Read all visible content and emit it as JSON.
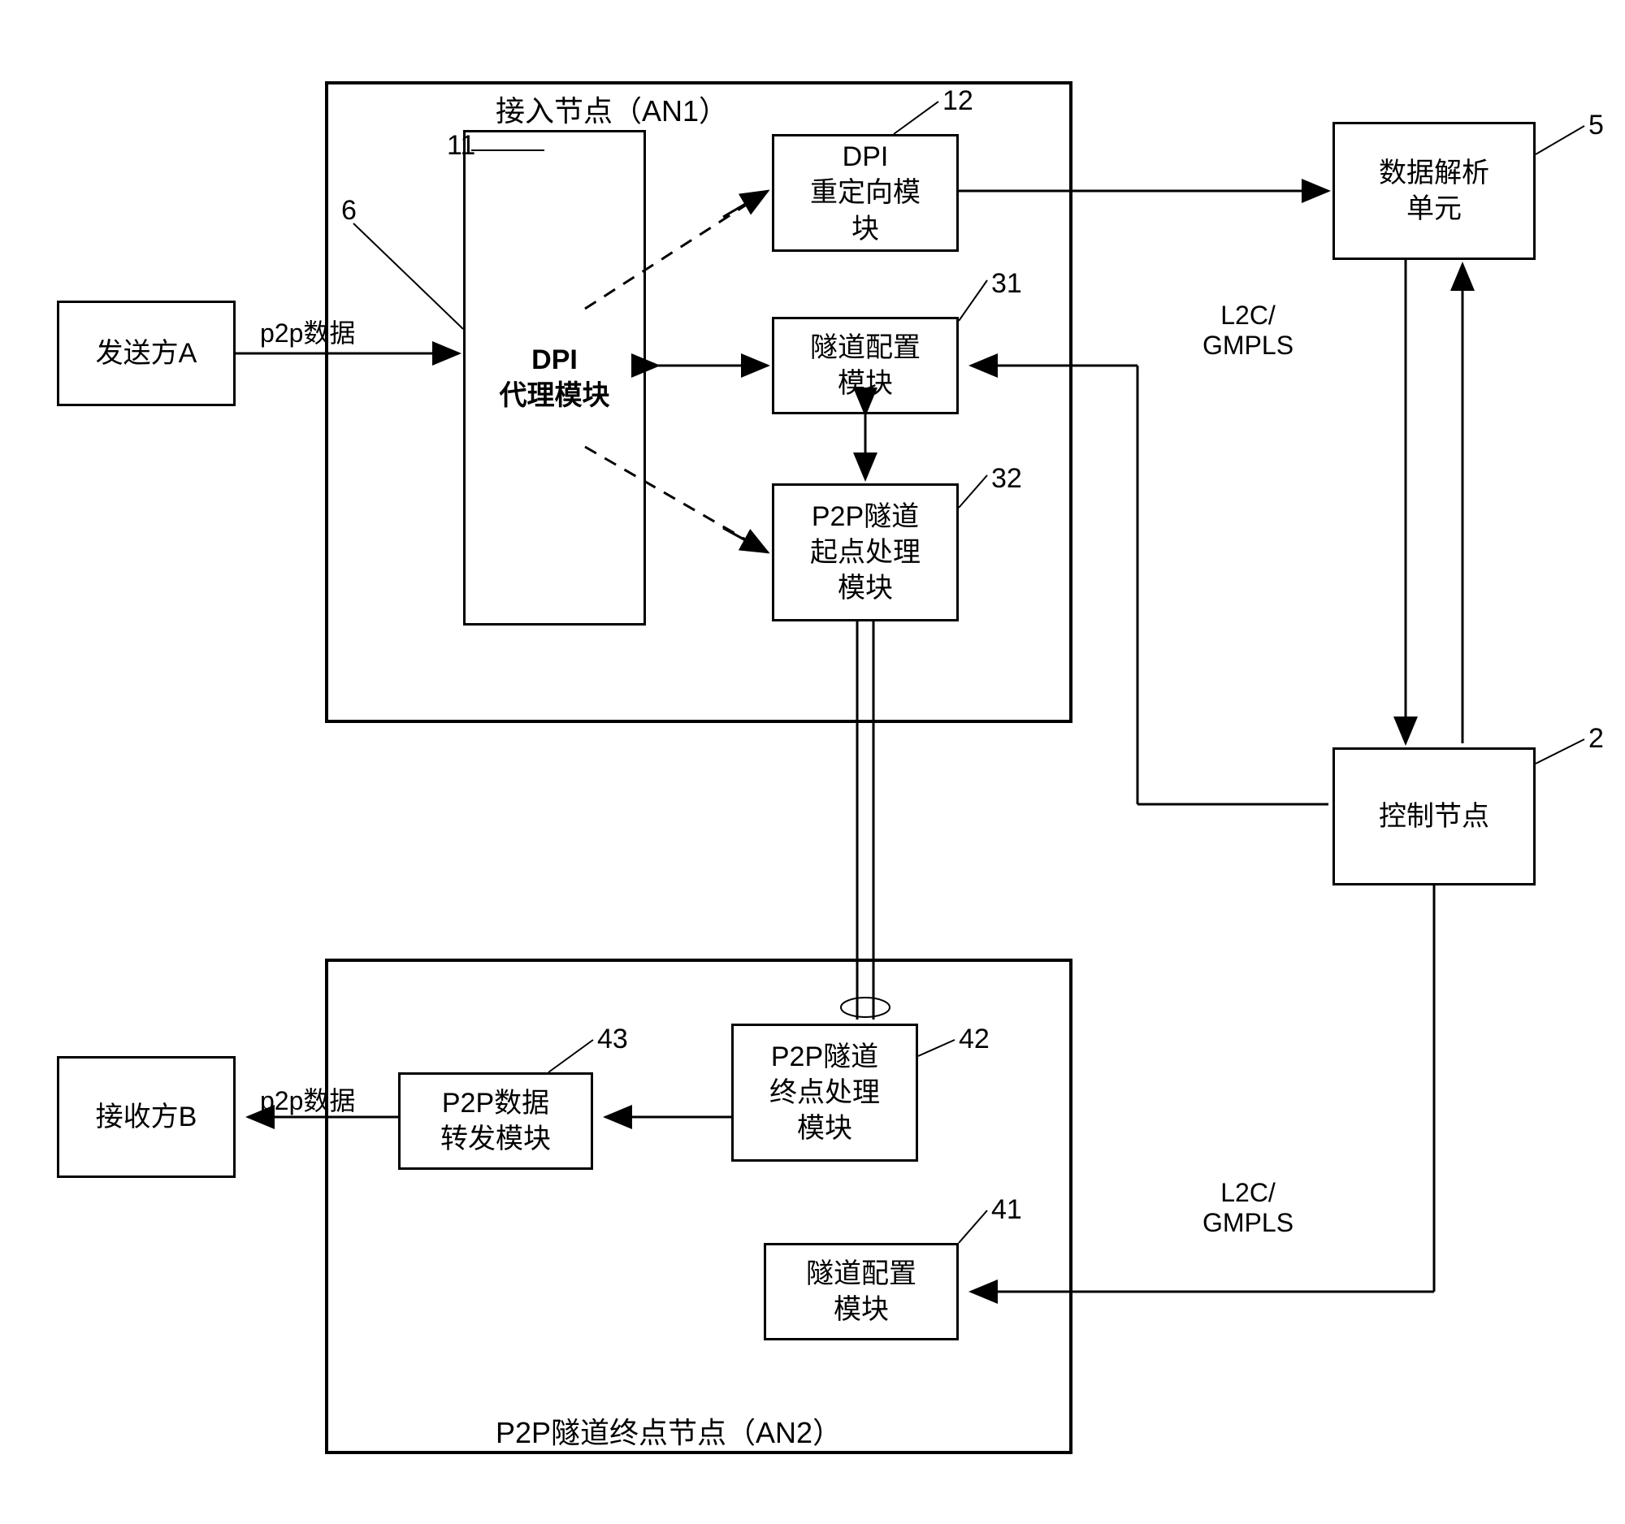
{
  "nodes": {
    "sender": "发送方A",
    "receiver": "接收方B",
    "dpi_proxy": "DPI\n代理模块",
    "dpi_redirect": "DPI\n重定向模\n块",
    "tunnel_config_1": "隧道配置\n模块",
    "p2p_tunnel_start": "P2P隧道\n起点处理\n模块",
    "data_parse": "数据解析\n单元",
    "control_node": "控制节点",
    "p2p_data_forward": "P2P数据\n转发模块",
    "p2p_tunnel_end": "P2P隧道\n终点处理\n模块",
    "tunnel_config_2": "隧道配置\n模块"
  },
  "containers": {
    "an1": "接入节点（AN1）",
    "an2": "P2P隧道终点节点（AN2）"
  },
  "labels": {
    "p2p_data_top": "p2p数据",
    "p2p_data_bottom": "p2p数据",
    "l2c_gmpls_top": "L2C/\nGMPLS",
    "l2c_gmpls_bottom": "L2C/\nGMPLS"
  },
  "refs": {
    "r6": "6",
    "r11": "11",
    "r12": "12",
    "r31": "31",
    "r32": "32",
    "r5": "5",
    "r2": "2",
    "r43": "43",
    "r42": "42",
    "r41": "41"
  }
}
